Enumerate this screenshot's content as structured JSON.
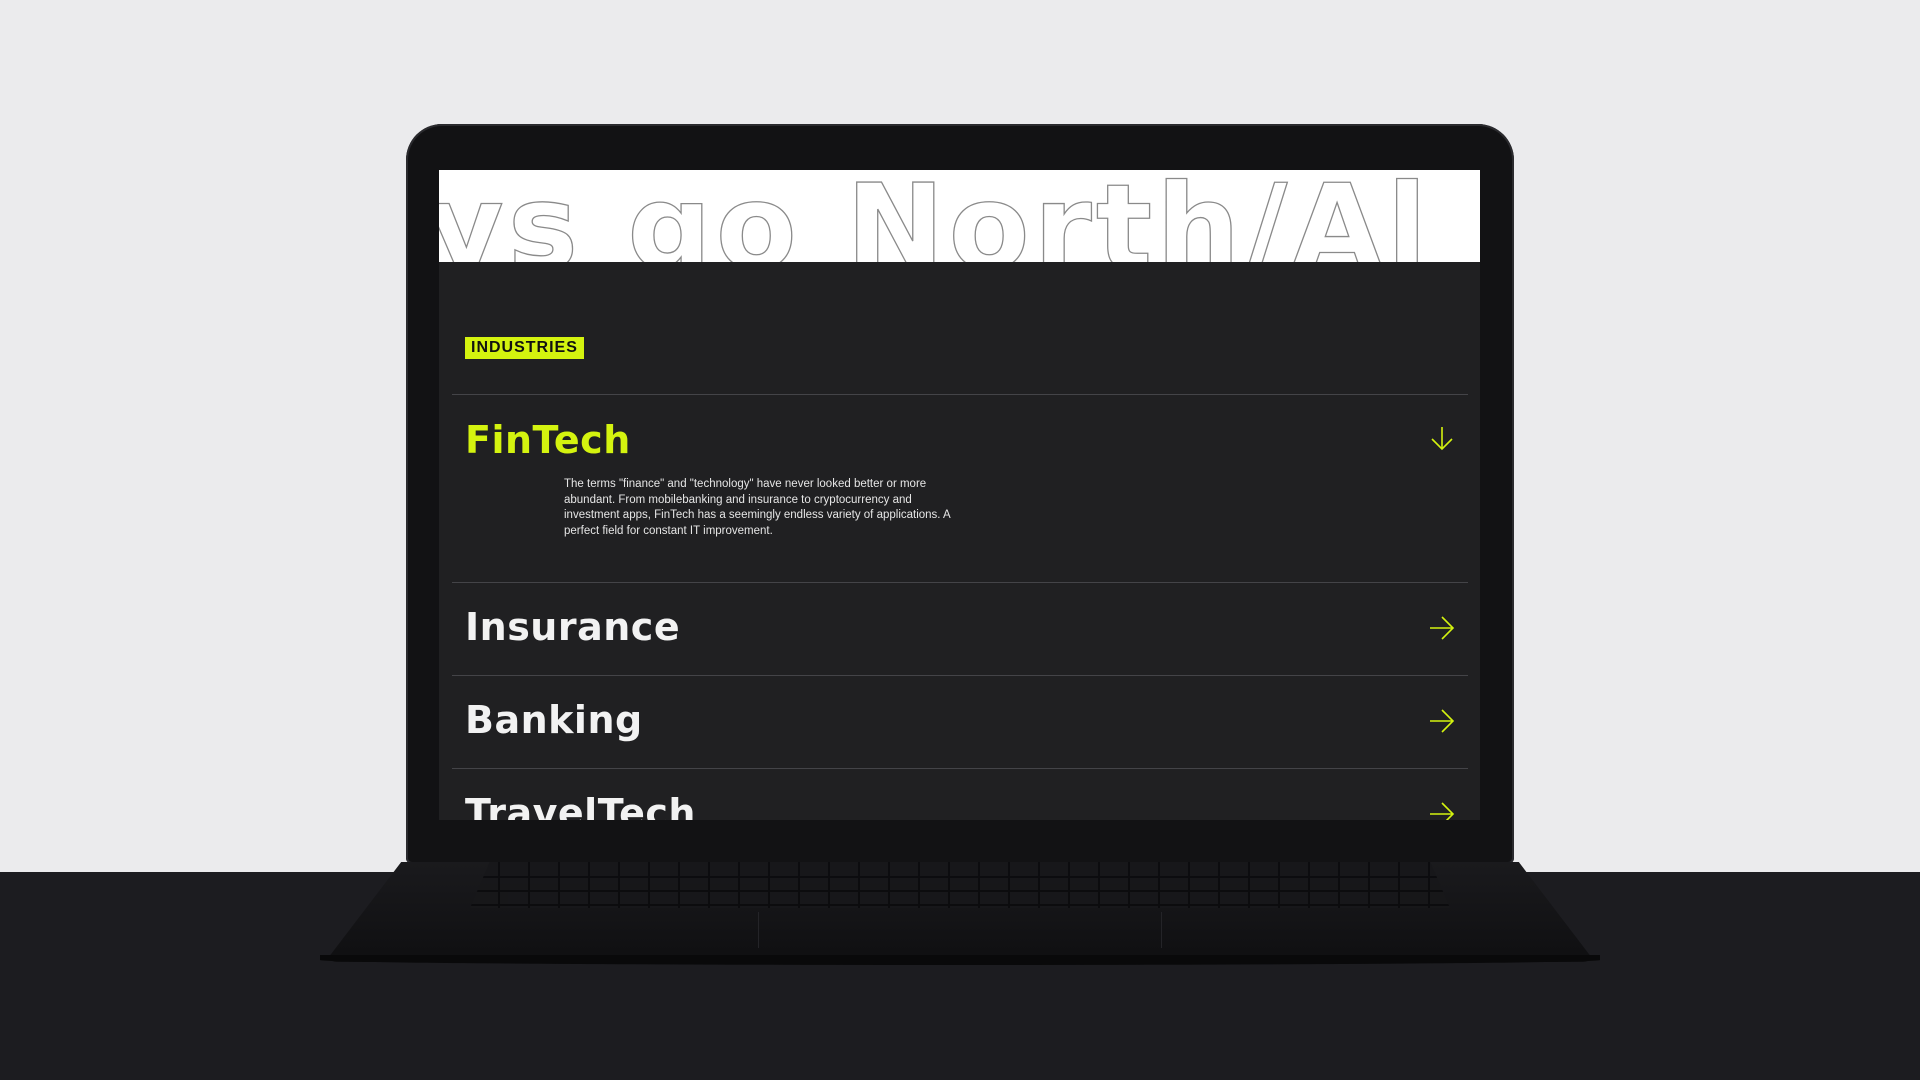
{
  "marquee": {
    "text": "ys go North/Al"
  },
  "section": {
    "badge": "INDUSTRIES"
  },
  "industries": [
    {
      "title": "FinTech",
      "expanded": true,
      "description": "The terms \"finance\" and \"technology\" have never looked better or more abundant. From mobilebanking and insurance to cryptocurrency and investment apps, FinTech has a seemingly endless variety of applications. A perfect field for constant IT improvement.",
      "icon": "arrow-down-icon"
    },
    {
      "title": "Insurance",
      "expanded": false,
      "icon": "arrow-right-icon"
    },
    {
      "title": "Banking",
      "expanded": false,
      "icon": "arrow-right-icon"
    },
    {
      "title": "TravelTech",
      "expanded": false,
      "icon": "arrow-right-icon"
    }
  ],
  "colors": {
    "accent": "#d4f30f",
    "screen_background": "#202022",
    "divider": "#444448",
    "text": "#f2f2f2"
  }
}
